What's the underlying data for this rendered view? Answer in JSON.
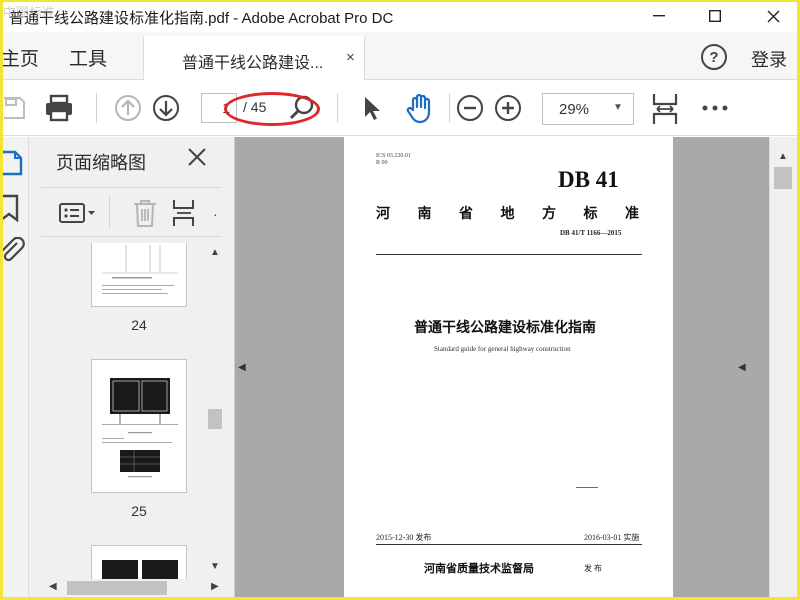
{
  "window": {
    "title": "普通干线公路建设标准化指南.pdf - Adobe Acrobat Pro DC",
    "watermark_top": "中国标准"
  },
  "tabs": {
    "home": "主页",
    "tools": "工具",
    "document": "普通干线公路建设...",
    "close": "×",
    "login": "登录"
  },
  "toolbar": {
    "current_page": "1",
    "total_pages": "/ 45",
    "zoom": "29%"
  },
  "panel": {
    "title": "页面缩略图",
    "thumbnails": [
      {
        "number": "24"
      },
      {
        "number": "25"
      }
    ]
  },
  "document_page": {
    "ics": "ICS 03.220.01",
    "ccs": "R 00",
    "db": "DB 41",
    "province_std": "河 南 省 地 方 标 准",
    "std_number": "DB 41/T 1166—2015",
    "title_cn": "普通干线公路建设标准化指南",
    "title_en": "Standard guide for general highway construction",
    "issued": "2015-12-30 发布",
    "implemented": "2016-03-01 实施",
    "issuer": "河南省质量技术监督局",
    "issuer_suffix": "发 布"
  },
  "colors": {
    "accent_blue": "#1b6ec2",
    "annotation_red": "#e0262b",
    "frame_yellow": "#f5e533"
  }
}
